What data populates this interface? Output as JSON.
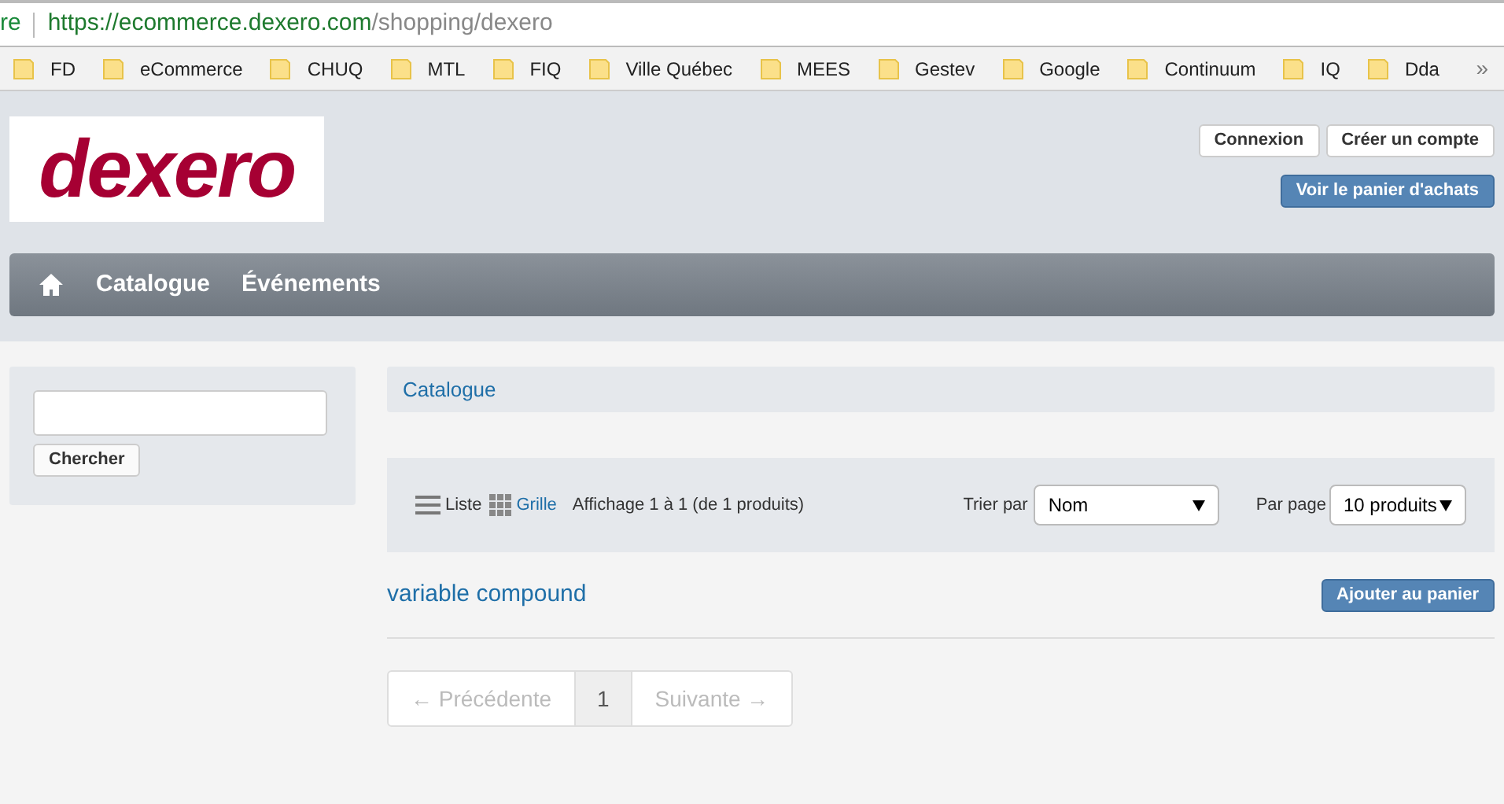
{
  "browser": {
    "address_prefix": "re",
    "url_host": "https://ecommerce.dexero.com",
    "url_path": "/shopping/dexero",
    "bookmarks": [
      "FD",
      "eCommerce",
      "CHUQ",
      "MTL",
      "FIQ",
      "Ville Québec",
      "MEES",
      "Gestev",
      "Google",
      "Continuum",
      "IQ",
      "Dda"
    ],
    "overflow": "»"
  },
  "header": {
    "logo": "dexero",
    "account_buttons": [
      "Connexion",
      "Créer un compte"
    ],
    "cart_button": "Voir le panier d'achats"
  },
  "nav": {
    "items": [
      "Catalogue",
      "Événements"
    ]
  },
  "sidebar": {
    "search_button": "Chercher"
  },
  "breadcrumb": "Catalogue",
  "toolbar": {
    "views": [
      {
        "label": "Liste",
        "kind": "list",
        "selected": true
      },
      {
        "label": "Grille",
        "kind": "grid",
        "selected": false
      }
    ],
    "summary": "Affichage 1 à 1 (de 1 produits)",
    "sort_label": "Trier par",
    "sort_value": "Nom",
    "per_page_label": "Par page",
    "per_page_value": "10 produits"
  },
  "products": [
    {
      "name": "variable compound",
      "button": "Ajouter au panier"
    }
  ],
  "pagination": [
    {
      "label": "← Précédente",
      "selected": false,
      "disabled": true
    },
    {
      "label": "1",
      "selected": true,
      "disabled": false
    },
    {
      "label": "Suivante →",
      "selected": false,
      "disabled": true
    }
  ]
}
